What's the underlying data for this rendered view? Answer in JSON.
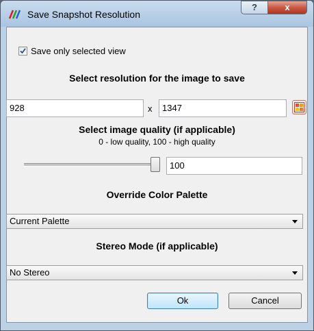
{
  "window": {
    "title": "Save Snapshot Resolution",
    "help_label": "?",
    "close_label": "x",
    "app_icon": "rgb-lines-icon"
  },
  "save_only_selected": {
    "label": "Save only selected view",
    "checked": true
  },
  "resolution": {
    "heading": "Select resolution for the image to save",
    "width": "928",
    "separator": "x",
    "height": "1347",
    "palette_button_icon": "grid-palette-icon"
  },
  "quality": {
    "heading": "Select image quality (if applicable)",
    "hint": "0 - low quality, 100 - high quality",
    "value": "100",
    "slider_level": 1.0
  },
  "color_palette": {
    "heading": "Override Color Palette",
    "selected": "Current Palette"
  },
  "stereo": {
    "heading": "Stereo Mode (if applicable)",
    "selected": "No Stereo"
  },
  "buttons": {
    "ok": "Ok",
    "cancel": "Cancel"
  },
  "colors": {
    "close_red": "#c85a45",
    "title_blue": "#bcd0e6",
    "default_button": "#bee6fd"
  }
}
